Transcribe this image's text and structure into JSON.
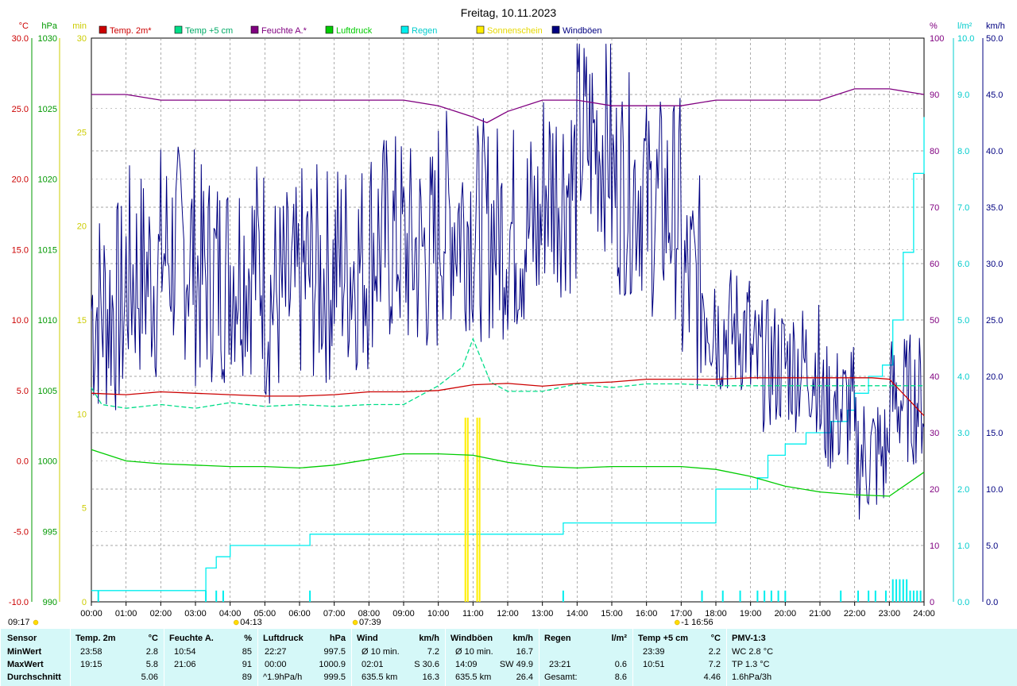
{
  "chart_data": {
    "type": "line",
    "title": "Freitag, 10.11.2023",
    "colors": {
      "temp2m": "#cc0000",
      "temp5cm": "#00dd88",
      "humidity": "#800080",
      "pressure": "#00cc00",
      "rain": "#00eeee",
      "sun": "#ffee00",
      "gusts": "#000080",
      "axisC": "#cc0000",
      "axisHpa": "#009900",
      "axisMin": "#cccc00",
      "axisPct": "#800080",
      "axisRain": "#00cccc",
      "axisKmh": "#000080",
      "grid": "#888888"
    },
    "legend": [
      {
        "key": "temp2m",
        "label": "Temp. 2m*"
      },
      {
        "key": "temp5cm",
        "label": "Temp +5 cm"
      },
      {
        "key": "humidity",
        "label": "Feuchte A.*"
      },
      {
        "key": "pressure",
        "label": "Luftdruck"
      },
      {
        "key": "rain",
        "label": "Regen"
      },
      {
        "key": "sun",
        "label": "Sonnenschein"
      },
      {
        "key": "gusts",
        "label": "Windböen"
      }
    ],
    "axes": {
      "left_c": {
        "unit": "°C",
        "min": -10,
        "max": 30,
        "ticks": [
          "30.0",
          "25.0",
          "20.0",
          "15.0",
          "10.0",
          "5.0",
          "0.0",
          "-5.0",
          "-10.0"
        ]
      },
      "left_hpa": {
        "unit": "hPa",
        "min": 990,
        "max": 1030,
        "ticks": [
          "1030",
          "1025",
          "1020",
          "1015",
          "1010",
          "1005",
          "1000",
          "995",
          "990"
        ]
      },
      "left_min": {
        "unit": "min",
        "min": 0,
        "max": 30,
        "ticks": [
          "30",
          "25",
          "20",
          "15",
          "10",
          "5",
          "0"
        ]
      },
      "right_pct": {
        "unit": "%",
        "min": 0,
        "max": 100,
        "ticks": [
          "100",
          "90",
          "80",
          "70",
          "60",
          "50",
          "40",
          "30",
          "20",
          "10",
          "0"
        ]
      },
      "right_rain": {
        "unit": "l/m²",
        "min": 0,
        "max": 10,
        "ticks": [
          "10.0",
          "9.0",
          "8.0",
          "7.0",
          "6.0",
          "5.0",
          "4.0",
          "3.0",
          "2.0",
          "1.0",
          "0.0"
        ]
      },
      "right_kmh": {
        "unit": "km/h",
        "min": 0,
        "max": 50,
        "ticks": [
          "50.0",
          "45.0",
          "40.0",
          "35.0",
          "30.0",
          "25.0",
          "20.0",
          "15.0",
          "10.0",
          "5.0",
          "0.0"
        ]
      }
    },
    "x_ticks": [
      "00:00",
      "01:00",
      "02:00",
      "03:00",
      "04:00",
      "05:00",
      "06:00",
      "07:00",
      "08:00",
      "09:00",
      "10:00",
      "11:00",
      "12:00",
      "13:00",
      "14:00",
      "15:00",
      "16:00",
      "17:00",
      "18:00",
      "19:00",
      "20:00",
      "21:00",
      "22:00",
      "23:00",
      "24:00"
    ],
    "markers": [
      {
        "label": "09:17",
        "x_hour": -1
      },
      {
        "label": "04:13",
        "x_hour": 4.22
      },
      {
        "label": "07:39",
        "x_hour": 7.65
      },
      {
        "label": "-1 16:56",
        "x_hour": 16.93
      }
    ],
    "series": {
      "temp2m": {
        "x": [
          0,
          1,
          2,
          3,
          4,
          5,
          6,
          7,
          8,
          9,
          10,
          11,
          12,
          13,
          14,
          15,
          16,
          17,
          18,
          19,
          20,
          21,
          22,
          22.5,
          23,
          23.5,
          24
        ],
        "y": [
          4.8,
          4.7,
          4.9,
          4.8,
          4.7,
          4.6,
          4.6,
          4.7,
          4.9,
          4.9,
          5.0,
          5.4,
          5.5,
          5.3,
          5.5,
          5.6,
          5.8,
          5.8,
          5.8,
          5.9,
          5.9,
          5.9,
          5.9,
          5.9,
          5.8,
          4.5,
          3.2
        ]
      },
      "temp5cm": {
        "x": [
          0,
          0.3,
          1,
          2,
          3,
          4,
          5,
          6,
          7,
          8,
          9,
          10,
          10.7,
          11,
          11.5,
          12,
          13,
          14,
          15,
          16,
          17,
          18,
          19,
          20,
          21,
          22,
          23,
          24
        ],
        "y": [
          11.4,
          10.5,
          10.3,
          10.5,
          10.3,
          10.6,
          10.4,
          10.5,
          10.4,
          10.5,
          10.5,
          11.5,
          12.5,
          14,
          11.7,
          11.2,
          11.2,
          11.6,
          11.4,
          11.6,
          11.6,
          11.5,
          11.5,
          11.5,
          11.5,
          11.5,
          11.5,
          11.5
        ]
      },
      "humidity": {
        "x": [
          0,
          1,
          2,
          3,
          4,
          5,
          6,
          7,
          8,
          9,
          10,
          10.5,
          11,
          11.4,
          12,
          13,
          14,
          15,
          16,
          17,
          18,
          19,
          20,
          21,
          22,
          23,
          24
        ],
        "y": [
          90,
          90,
          89,
          89,
          89,
          89,
          89,
          89,
          89,
          89,
          88,
          87,
          86,
          85,
          87,
          89,
          89,
          88,
          88,
          88,
          89,
          89,
          89,
          89,
          91,
          91,
          90
        ]
      },
      "pressure": {
        "x": [
          0,
          1,
          2,
          3,
          4,
          5,
          6,
          7,
          8,
          9,
          10,
          11,
          12,
          13,
          14,
          15,
          16,
          17,
          18,
          19,
          20,
          21,
          22,
          23,
          24
        ],
        "y": [
          1000.8,
          1000,
          999.8,
          999.7,
          999.6,
          999.6,
          999.5,
          999.7,
          1000.1,
          1000.5,
          1000.5,
          1000.4,
          999.9,
          999.6,
          999.5,
          999.6,
          999.6,
          999.6,
          999.4,
          998.9,
          998.2,
          997.8,
          997.6,
          997.5,
          999.2
        ]
      },
      "rain": {
        "x": [
          0,
          3.1,
          3.3,
          3.6,
          4,
          5,
          6,
          6.3,
          7,
          8,
          9,
          10,
          11,
          12,
          13,
          13.6,
          14,
          15,
          16,
          17,
          17.6,
          18,
          18.7,
          19.2,
          19.5,
          20,
          20.6,
          21,
          21.3,
          21.8,
          22,
          22.4,
          22.8,
          23.1,
          23.4,
          23.7,
          24
        ],
        "y": [
          0.2,
          0.2,
          0.6,
          0.8,
          1.0,
          1.0,
          1.0,
          1.2,
          1.2,
          1.2,
          1.2,
          1.2,
          1.2,
          1.2,
          1.2,
          1.4,
          1.4,
          1.4,
          1.4,
          1.4,
          1.4,
          2.0,
          2.0,
          2.2,
          2.6,
          2.8,
          3.0,
          3.0,
          3.2,
          3.4,
          3.7,
          4.0,
          4.2,
          5.0,
          6.2,
          7.6,
          8.6
        ]
      },
      "sun": {
        "x": [
          10.78,
          10.85,
          11.12,
          11.19
        ],
        "y": [
          9.8,
          9.8,
          9.8,
          9.8
        ]
      },
      "gusts": {
        "hourly_avg": [
          26,
          29,
          31,
          29,
          30,
          27,
          29,
          30,
          32,
          31,
          34,
          33,
          33,
          37,
          41,
          37,
          35,
          28,
          24,
          21,
          21,
          17,
          13,
          18
        ],
        "range": [
          14.2,
          14.2
        ]
      }
    }
  },
  "stats": {
    "sensor": {
      "title": "Sensor",
      "rows": [
        "MinWert",
        "MaxWert",
        "Durchschnitt"
      ]
    },
    "temp2m": {
      "title": "Temp. 2m",
      "unit": "°C",
      "min_time": "23:58",
      "min_val": "2.8",
      "max_time": "19:15",
      "max_val": "5.8",
      "avg": "5.06"
    },
    "humidity": {
      "title": "Feuchte A.",
      "unit": "%",
      "min_time": "10:54",
      "min_val": "85",
      "max_time": "21:06",
      "max_val": "91",
      "avg": "89"
    },
    "pressure": {
      "title": "Luftdruck",
      "unit": "hPa",
      "min_time": "22:27",
      "min_val": "997.5",
      "max_time": "00:00",
      "max_val": "1000.9",
      "avg_label": "^1.9hPa/h",
      "avg": "999.5"
    },
    "wind": {
      "title": "Wind",
      "unit": "km/h",
      "row1_label": "Ø 10 min.",
      "row1_val": "7.2",
      "row2_time": "02:01",
      "row2_val": "S 30.6",
      "row3_label": "635.5 km",
      "row3_val": "16.3"
    },
    "gusts": {
      "title": "Windböen",
      "unit": "km/h",
      "row1_label": "Ø 10 min.",
      "row1_val": "16.7",
      "row2_time": "14:09",
      "row2_val": "SW 49.9",
      "row3_label": "635.5 km",
      "row3_val": "26.4"
    },
    "rain": {
      "title": "Regen",
      "unit": "l/m²",
      "max_time": "23:21",
      "max_val": "0.6",
      "total_label": "Gesamt:",
      "total_val": "8.6"
    },
    "temp5cm": {
      "title": "Temp +5 cm",
      "unit": "°C",
      "min_time": "23:39",
      "min_val": "2.2",
      "max_time": "10:51",
      "max_val": "7.2",
      "avg": "4.46"
    },
    "pmv": {
      "title": "PMV-1:3",
      "row1": "WC 2.8 °C",
      "row2": "TP 1.3 °C",
      "row3": "1.6hPa/3h"
    }
  }
}
